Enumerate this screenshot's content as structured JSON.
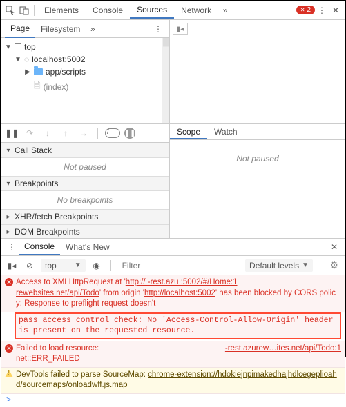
{
  "topbar": {
    "tabs": {
      "elements": "Elements",
      "console": "Console",
      "sources": "Sources",
      "network": "Network"
    },
    "error_count": "2"
  },
  "nav": {
    "page": "Page",
    "filesystem": "Filesystem"
  },
  "tree": {
    "top": "top",
    "host": "localhost:5002",
    "folder": "app/scripts",
    "file": "(index)"
  },
  "callstack": {
    "title": "Call Stack",
    "body": "Not paused"
  },
  "breakpoints": {
    "title": "Breakpoints",
    "body": "No breakpoints"
  },
  "xhr": {
    "title": "XHR/fetch Breakpoints"
  },
  "dom": {
    "title": "DOM Breakpoints"
  },
  "scope": {
    "scope": "Scope",
    "watch": "Watch",
    "body": "Not paused"
  },
  "drawer": {
    "console": "Console",
    "whatsnew": "What's New"
  },
  "consoleHdr": {
    "context": "top",
    "filter_ph": "Filter",
    "levels": "Default levels"
  },
  "msgs": {
    "err1_pre": "Access to XMLHttpRequest at '",
    "err1_url1": "http://        -rest.azu :5002/#/Home:1",
    "err1_mid1": "rewebsites.net/api/Todo",
    "err1_mid2": "' from origin '",
    "err1_url2": "http://localhost:5002",
    "err1_tail": "' has been blocked by CORS policy: Response to preflight request doesn't",
    "hbox": "pass access control check: No 'Access-Control-Allow-Origin' header is present on the requested resource.",
    "err2_pre": "Failed to load resource: ",
    "err2_url": "     -rest.azurew…ites.net/api/Todo:1",
    "err2_tail": "net::ERR_FAILED",
    "warn_pre": "DevTools failed to parse SourceMap: ",
    "warn_url": "chrome-extension://hdokiejnpimakedhajhdlcegeplioahd/sourcemaps/onloadwff.js.map"
  },
  "prompt": ">"
}
